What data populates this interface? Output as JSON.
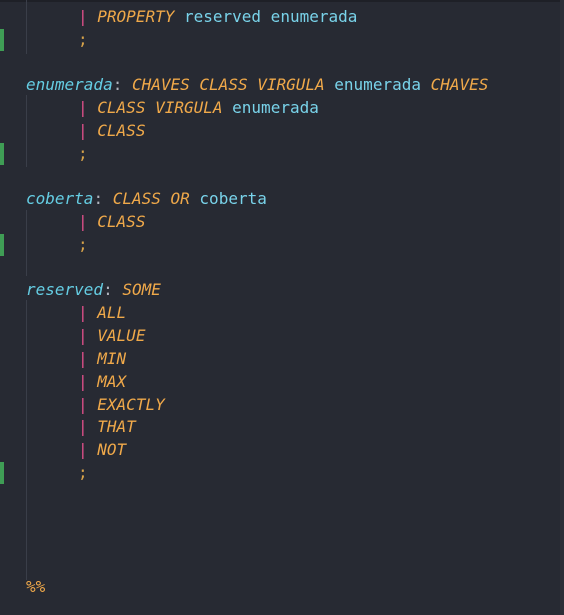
{
  "editor": {
    "lines": {
      "l1": {
        "pipe": "|",
        "tok": "PROPERTY",
        "ids": "reserved enumerada"
      },
      "l2": {
        "semi": ";"
      },
      "l3": {
        "name": "enumerada",
        "colon": ":",
        "toks": "CHAVES CLASS VIRGULA",
        "id": "enumerada",
        "tok2": "CHAVES"
      },
      "l4": {
        "pipe": "|",
        "toks": "CLASS VIRGULA",
        "id": "enumerada"
      },
      "l5": {
        "pipe": "|",
        "tok": "CLASS"
      },
      "l6": {
        "semi": ";"
      },
      "l7": {
        "name": "coberta",
        "colon": ":",
        "toks": "CLASS OR",
        "id": "coberta"
      },
      "l8": {
        "pipe": "|",
        "tok": "CLASS"
      },
      "l9": {
        "semi": ";"
      },
      "l10": {
        "name": "reserved",
        "colon": ":",
        "tok": "SOME"
      },
      "l11": {
        "pipe": "|",
        "tok": "ALL"
      },
      "l12": {
        "pipe": "|",
        "tok": "VALUE"
      },
      "l13": {
        "pipe": "|",
        "tok": "MIN"
      },
      "l14": {
        "pipe": "|",
        "tok": "MAX"
      },
      "l15": {
        "pipe": "|",
        "tok": "EXACTLY"
      },
      "l16": {
        "pipe": "|",
        "tok": "THAT"
      },
      "l17": {
        "pipe": "|",
        "tok": "NOT"
      },
      "l18": {
        "semi": ";"
      },
      "l19": {
        "pct": "%%"
      }
    }
  },
  "colors": {
    "background": "#272a33",
    "nonterminal": "#65cde3",
    "token": "#f0a94a",
    "pipe": "#e0508a",
    "gutter_added": "#3f9d55"
  }
}
